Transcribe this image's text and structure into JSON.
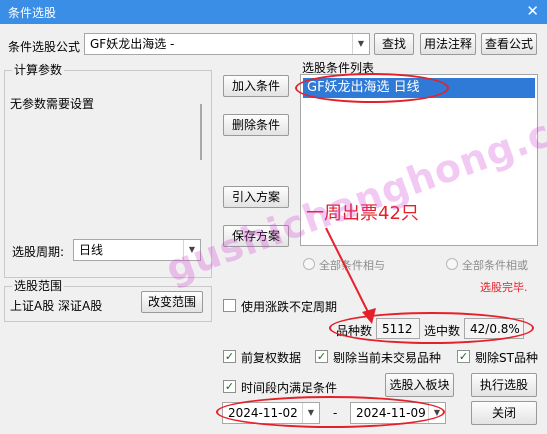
{
  "window": {
    "title": "条件选股",
    "close_glyph": "✕"
  },
  "formula": {
    "label": "条件选股公式",
    "value": "GF妖龙出海选  -",
    "find": "查找",
    "usage": "用法注释",
    "view": "查看公式"
  },
  "calc": {
    "title": "计算参数",
    "text": "无参数需要设置",
    "period_label": "选股周期:",
    "period_value": "日线"
  },
  "actions": {
    "add": "加入条件",
    "delete": "删除条件",
    "import": "引入方案",
    "save": "保存方案"
  },
  "list": {
    "title": "选股条件列表",
    "items": [
      "GF妖龙出海选  日线"
    ]
  },
  "logic": {
    "and": "全部条件相与",
    "or": "全部条件相或"
  },
  "status": {
    "text": "选股完毕."
  },
  "annotation": {
    "text": "一周出票42只"
  },
  "range": {
    "title": "选股范围",
    "text": "上证A股 深证A股",
    "change": "改变范围"
  },
  "stats": {
    "use_limit": "使用涨跌不定周期",
    "count_label": "品种数",
    "count_value": "5112",
    "hit_label": "选中数",
    "hit_value": "42/0.8%"
  },
  "options": {
    "adjust": "前复权数据",
    "exclude_untraded": "剔除当前未交易品种",
    "exclude_st": "剔除ST品种",
    "period_cond": "时间段内满足条件",
    "check_glyph": "✓"
  },
  "buttons": {
    "to_block": "选股入板块",
    "run": "执行选股",
    "close": "关闭"
  },
  "dates": {
    "start": "2024-11-02",
    "separator": "-",
    "end": "2024-11-09"
  },
  "watermark": "gushichanghong.com"
}
